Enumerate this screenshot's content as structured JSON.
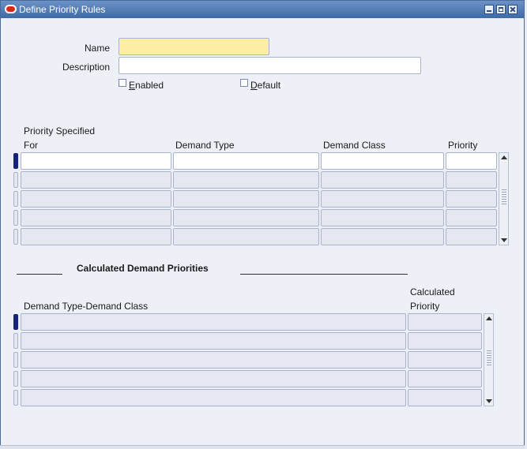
{
  "window": {
    "title": "Define Priority Rules"
  },
  "form": {
    "name_label": "Name",
    "name_value": "",
    "description_label": "Description",
    "description_value": "",
    "enabled_prefix": "",
    "enabled_accel": "E",
    "enabled_rest": "nabled",
    "default_accel": "D",
    "default_rest": "efault"
  },
  "rules_table": {
    "headers": {
      "priority_specified_line1": "Priority Specified",
      "priority_specified_line2": "For",
      "demand_type": "Demand Type",
      "demand_class": "Demand Class",
      "priority": "Priority"
    },
    "rows": [
      {
        "for": "",
        "demand_type": "",
        "demand_class": "",
        "priority": ""
      },
      {
        "for": "",
        "demand_type": "",
        "demand_class": "",
        "priority": ""
      },
      {
        "for": "",
        "demand_type": "",
        "demand_class": "",
        "priority": ""
      },
      {
        "for": "",
        "demand_type": "",
        "demand_class": "",
        "priority": ""
      },
      {
        "for": "",
        "demand_type": "",
        "demand_class": "",
        "priority": ""
      }
    ]
  },
  "calculated": {
    "section_title": "Calculated Demand Priorities",
    "headers": {
      "demand_type_class": "Demand Type-Demand Class",
      "calculated_line1": "Calculated",
      "calculated_line2": "Priority"
    },
    "rows": [
      {
        "type_class": "",
        "priority": ""
      },
      {
        "type_class": "",
        "priority": ""
      },
      {
        "type_class": "",
        "priority": ""
      },
      {
        "type_class": "",
        "priority": ""
      },
      {
        "type_class": "",
        "priority": ""
      }
    ]
  },
  "colors": {
    "titlebar": "#3f6aa6",
    "required_field": "#fdeea3",
    "current_record": "#16237a",
    "background": "#eef0f7"
  }
}
